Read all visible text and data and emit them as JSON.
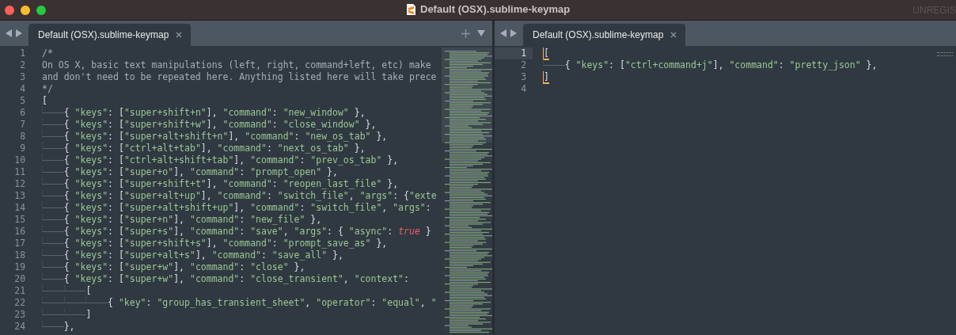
{
  "window": {
    "title": "Default (OSX).sublime-keymap",
    "license_notice": "UNREGIS"
  },
  "panes": [
    {
      "tabs": [
        {
          "label": "Default (OSX).sublime-keymap",
          "selected": true
        }
      ],
      "has_new_tab": true,
      "minimap": {
        "kind": "full"
      },
      "lines": [
        {
          "number": "1",
          "current": false,
          "tokens": [
            {
              "kind": "comment",
              "text": "/*"
            }
          ]
        },
        {
          "number": "2",
          "current": false,
          "tokens": [
            {
              "kind": "comment",
              "text": "On OS X, basic text manipulations (left, right, command+left, etc) make"
            }
          ]
        },
        {
          "number": "3",
          "current": false,
          "tokens": [
            {
              "kind": "comment",
              "text": "and don't need to be repeated here. Anything listed here will take prece"
            }
          ]
        },
        {
          "number": "4",
          "current": false,
          "tokens": [
            {
              "kind": "comment",
              "text": "*/"
            }
          ]
        },
        {
          "number": "5",
          "current": false,
          "tokens": [
            {
              "kind": "punct",
              "text": "["
            }
          ]
        },
        {
          "number": "6",
          "current": false,
          "tokens": [
            {
              "kind": "punct",
              "text": "\t{ "
            },
            {
              "kind": "string",
              "text": "\"keys\""
            },
            {
              "kind": "punct",
              "text": ": ["
            },
            {
              "kind": "string",
              "text": "\"super+shift+n\""
            },
            {
              "kind": "punct",
              "text": "], "
            },
            {
              "kind": "string",
              "text": "\"command\""
            },
            {
              "kind": "punct",
              "text": ": "
            },
            {
              "kind": "string",
              "text": "\"new_window\""
            },
            {
              "kind": "punct",
              "text": " },"
            }
          ]
        },
        {
          "number": "7",
          "current": false,
          "tokens": [
            {
              "kind": "punct",
              "text": "\t{ "
            },
            {
              "kind": "string",
              "text": "\"keys\""
            },
            {
              "kind": "punct",
              "text": ": ["
            },
            {
              "kind": "string",
              "text": "\"super+shift+w\""
            },
            {
              "kind": "punct",
              "text": "], "
            },
            {
              "kind": "string",
              "text": "\"command\""
            },
            {
              "kind": "punct",
              "text": ": "
            },
            {
              "kind": "string",
              "text": "\"close_window\""
            },
            {
              "kind": "punct",
              "text": " },"
            }
          ]
        },
        {
          "number": "8",
          "current": false,
          "tokens": [
            {
              "kind": "punct",
              "text": "\t{ "
            },
            {
              "kind": "string",
              "text": "\"keys\""
            },
            {
              "kind": "punct",
              "text": ": ["
            },
            {
              "kind": "string",
              "text": "\"super+alt+shift+n\""
            },
            {
              "kind": "punct",
              "text": "], "
            },
            {
              "kind": "string",
              "text": "\"command\""
            },
            {
              "kind": "punct",
              "text": ": "
            },
            {
              "kind": "string",
              "text": "\"new_os_tab\""
            },
            {
              "kind": "punct",
              "text": " },"
            }
          ]
        },
        {
          "number": "9",
          "current": false,
          "tokens": [
            {
              "kind": "punct",
              "text": "\t{ "
            },
            {
              "kind": "string",
              "text": "\"keys\""
            },
            {
              "kind": "punct",
              "text": ": ["
            },
            {
              "kind": "string",
              "text": "\"ctrl+alt+tab\""
            },
            {
              "kind": "punct",
              "text": "], "
            },
            {
              "kind": "string",
              "text": "\"command\""
            },
            {
              "kind": "punct",
              "text": ": "
            },
            {
              "kind": "string",
              "text": "\"next_os_tab\""
            },
            {
              "kind": "punct",
              "text": " },"
            }
          ]
        },
        {
          "number": "10",
          "current": false,
          "tokens": [
            {
              "kind": "punct",
              "text": "\t{ "
            },
            {
              "kind": "string",
              "text": "\"keys\""
            },
            {
              "kind": "punct",
              "text": ": ["
            },
            {
              "kind": "string",
              "text": "\"ctrl+alt+shift+tab\""
            },
            {
              "kind": "punct",
              "text": "], "
            },
            {
              "kind": "string",
              "text": "\"command\""
            },
            {
              "kind": "punct",
              "text": ": "
            },
            {
              "kind": "string",
              "text": "\"prev_os_tab\""
            },
            {
              "kind": "punct",
              "text": " },"
            }
          ]
        },
        {
          "number": "11",
          "current": false,
          "tokens": [
            {
              "kind": "punct",
              "text": "\t{ "
            },
            {
              "kind": "string",
              "text": "\"keys\""
            },
            {
              "kind": "punct",
              "text": ": ["
            },
            {
              "kind": "string",
              "text": "\"super+o\""
            },
            {
              "kind": "punct",
              "text": "], "
            },
            {
              "kind": "string",
              "text": "\"command\""
            },
            {
              "kind": "punct",
              "text": ": "
            },
            {
              "kind": "string",
              "text": "\"prompt_open\""
            },
            {
              "kind": "punct",
              "text": " },"
            }
          ]
        },
        {
          "number": "12",
          "current": false,
          "tokens": [
            {
              "kind": "punct",
              "text": "\t{ "
            },
            {
              "kind": "string",
              "text": "\"keys\""
            },
            {
              "kind": "punct",
              "text": ": ["
            },
            {
              "kind": "string",
              "text": "\"super+shift+t\""
            },
            {
              "kind": "punct",
              "text": "], "
            },
            {
              "kind": "string",
              "text": "\"command\""
            },
            {
              "kind": "punct",
              "text": ": "
            },
            {
              "kind": "string",
              "text": "\"reopen_last_file\""
            },
            {
              "kind": "punct",
              "text": " },"
            }
          ]
        },
        {
          "number": "13",
          "current": false,
          "tokens": [
            {
              "kind": "punct",
              "text": "\t{ "
            },
            {
              "kind": "string",
              "text": "\"keys\""
            },
            {
              "kind": "punct",
              "text": ": ["
            },
            {
              "kind": "string",
              "text": "\"super+alt+up\""
            },
            {
              "kind": "punct",
              "text": "], "
            },
            {
              "kind": "string",
              "text": "\"command\""
            },
            {
              "kind": "punct",
              "text": ": "
            },
            {
              "kind": "string",
              "text": "\"switch_file\""
            },
            {
              "kind": "punct",
              "text": ", "
            },
            {
              "kind": "string",
              "text": "\"args\""
            },
            {
              "kind": "punct",
              "text": ": {"
            },
            {
              "kind": "string",
              "text": "\"exte"
            }
          ]
        },
        {
          "number": "14",
          "current": false,
          "tokens": [
            {
              "kind": "punct",
              "text": "\t{ "
            },
            {
              "kind": "string",
              "text": "\"keys\""
            },
            {
              "kind": "punct",
              "text": ": ["
            },
            {
              "kind": "string",
              "text": "\"super+alt+shift+up\""
            },
            {
              "kind": "punct",
              "text": "], "
            },
            {
              "kind": "string",
              "text": "\"command\""
            },
            {
              "kind": "punct",
              "text": ": "
            },
            {
              "kind": "string",
              "text": "\"switch_file\""
            },
            {
              "kind": "punct",
              "text": ", "
            },
            {
              "kind": "string",
              "text": "\"args\""
            },
            {
              "kind": "punct",
              "text": ":"
            }
          ]
        },
        {
          "number": "15",
          "current": false,
          "tokens": [
            {
              "kind": "punct",
              "text": "\t{ "
            },
            {
              "kind": "string",
              "text": "\"keys\""
            },
            {
              "kind": "punct",
              "text": ": ["
            },
            {
              "kind": "string",
              "text": "\"super+n\""
            },
            {
              "kind": "punct",
              "text": "], "
            },
            {
              "kind": "string",
              "text": "\"command\""
            },
            {
              "kind": "punct",
              "text": ": "
            },
            {
              "kind": "string",
              "text": "\"new_file\""
            },
            {
              "kind": "punct",
              "text": " },"
            }
          ]
        },
        {
          "number": "16",
          "current": false,
          "tokens": [
            {
              "kind": "punct",
              "text": "\t{ "
            },
            {
              "kind": "string",
              "text": "\"keys\""
            },
            {
              "kind": "punct",
              "text": ": ["
            },
            {
              "kind": "string",
              "text": "\"super+s\""
            },
            {
              "kind": "punct",
              "text": "], "
            },
            {
              "kind": "string",
              "text": "\"command\""
            },
            {
              "kind": "punct",
              "text": ": "
            },
            {
              "kind": "string",
              "text": "\"save\""
            },
            {
              "kind": "punct",
              "text": ", "
            },
            {
              "kind": "string",
              "text": "\"args\""
            },
            {
              "kind": "punct",
              "text": ": { "
            },
            {
              "kind": "string",
              "text": "\"async\""
            },
            {
              "kind": "punct",
              "text": ": "
            },
            {
              "kind": "constant",
              "text": "true"
            },
            {
              "kind": "punct",
              "text": " }"
            }
          ]
        },
        {
          "number": "17",
          "current": false,
          "tokens": [
            {
              "kind": "punct",
              "text": "\t{ "
            },
            {
              "kind": "string",
              "text": "\"keys\""
            },
            {
              "kind": "punct",
              "text": ": ["
            },
            {
              "kind": "string",
              "text": "\"super+shift+s\""
            },
            {
              "kind": "punct",
              "text": "], "
            },
            {
              "kind": "string",
              "text": "\"command\""
            },
            {
              "kind": "punct",
              "text": ": "
            },
            {
              "kind": "string",
              "text": "\"prompt_save_as\""
            },
            {
              "kind": "punct",
              "text": " },"
            }
          ]
        },
        {
          "number": "18",
          "current": false,
          "tokens": [
            {
              "kind": "punct",
              "text": "\t{ "
            },
            {
              "kind": "string",
              "text": "\"keys\""
            },
            {
              "kind": "punct",
              "text": ": ["
            },
            {
              "kind": "string",
              "text": "\"super+alt+s\""
            },
            {
              "kind": "punct",
              "text": "], "
            },
            {
              "kind": "string",
              "text": "\"command\""
            },
            {
              "kind": "punct",
              "text": ": "
            },
            {
              "kind": "string",
              "text": "\"save_all\""
            },
            {
              "kind": "punct",
              "text": " },"
            }
          ]
        },
        {
          "number": "19",
          "current": false,
          "tokens": [
            {
              "kind": "punct",
              "text": "\t{ "
            },
            {
              "kind": "string",
              "text": "\"keys\""
            },
            {
              "kind": "punct",
              "text": ": ["
            },
            {
              "kind": "string",
              "text": "\"super+w\""
            },
            {
              "kind": "punct",
              "text": "], "
            },
            {
              "kind": "string",
              "text": "\"command\""
            },
            {
              "kind": "punct",
              "text": ": "
            },
            {
              "kind": "string",
              "text": "\"close\""
            },
            {
              "kind": "punct",
              "text": " },"
            }
          ]
        },
        {
          "number": "20",
          "current": false,
          "tokens": [
            {
              "kind": "punct",
              "text": "\t{ "
            },
            {
              "kind": "string",
              "text": "\"keys\""
            },
            {
              "kind": "punct",
              "text": ": ["
            },
            {
              "kind": "string",
              "text": "\"super+w\""
            },
            {
              "kind": "punct",
              "text": "], "
            },
            {
              "kind": "string",
              "text": "\"command\""
            },
            {
              "kind": "punct",
              "text": ": "
            },
            {
              "kind": "string",
              "text": "\"close_transient\""
            },
            {
              "kind": "punct",
              "text": ", "
            },
            {
              "kind": "string",
              "text": "\"context\""
            },
            {
              "kind": "punct",
              "text": ":"
            }
          ]
        },
        {
          "number": "21",
          "current": false,
          "tokens": [
            {
              "kind": "punct",
              "text": "\t\t["
            }
          ]
        },
        {
          "number": "22",
          "current": false,
          "tokens": [
            {
              "kind": "punct",
              "text": "\t\t\t{ "
            },
            {
              "kind": "string",
              "text": "\"key\""
            },
            {
              "kind": "punct",
              "text": ": "
            },
            {
              "kind": "string",
              "text": "\"group_has_transient_sheet\""
            },
            {
              "kind": "punct",
              "text": ", "
            },
            {
              "kind": "string",
              "text": "\"operator\""
            },
            {
              "kind": "punct",
              "text": ": "
            },
            {
              "kind": "string",
              "text": "\"equal\""
            },
            {
              "kind": "punct",
              "text": ", "
            },
            {
              "kind": "string",
              "text": "\""
            }
          ]
        },
        {
          "number": "23",
          "current": false,
          "tokens": [
            {
              "kind": "punct",
              "text": "\t\t]"
            }
          ]
        },
        {
          "number": "24",
          "current": false,
          "tokens": [
            {
              "kind": "punct",
              "text": "\t},"
            }
          ]
        }
      ]
    },
    {
      "tabs": [
        {
          "label": "Default (OSX).sublime-keymap",
          "selected": true
        }
      ],
      "has_new_tab": false,
      "minimap": {
        "kind": "compact"
      },
      "lines": [
        {
          "number": "1",
          "current": true,
          "tokens": [
            {
              "kind": "bracket",
              "text": "["
            }
          ]
        },
        {
          "number": "2",
          "current": false,
          "tokens": [
            {
              "kind": "punct",
              "text": "\t{ "
            },
            {
              "kind": "string",
              "text": "\"keys\""
            },
            {
              "kind": "punct",
              "text": ": ["
            },
            {
              "kind": "string",
              "text": "\"ctrl+command+j\""
            },
            {
              "kind": "punct",
              "text": "], "
            },
            {
              "kind": "string",
              "text": "\"command\""
            },
            {
              "kind": "punct",
              "text": ": "
            },
            {
              "kind": "string",
              "text": "\"pretty_json\""
            },
            {
              "kind": "punct",
              "text": " },"
            }
          ]
        },
        {
          "number": "3",
          "current": false,
          "tokens": [
            {
              "kind": "bracket",
              "text": "]"
            }
          ]
        },
        {
          "number": "4",
          "current": false
        }
      ]
    }
  ]
}
